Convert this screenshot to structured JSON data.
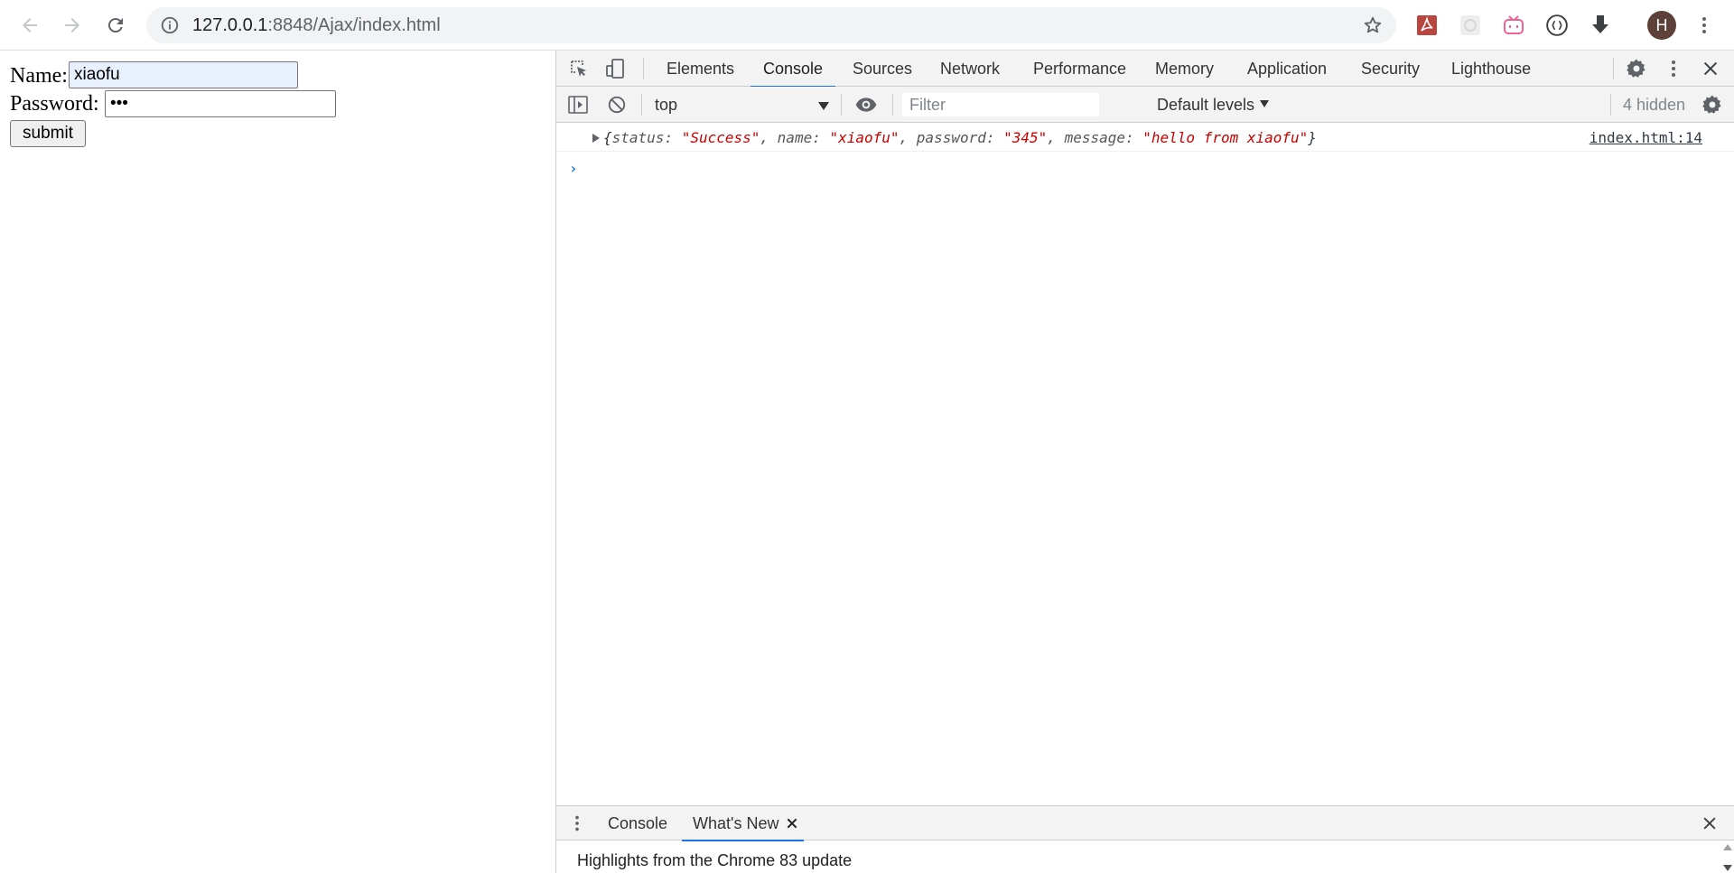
{
  "browser": {
    "url_host": "127.0.0.1",
    "url_rest": ":8848/Ajax/index.html",
    "profile_initial": "H",
    "icons": {
      "back": "arrow-left-icon",
      "forward": "arrow-right-icon",
      "reload": "reload-icon",
      "site_info": "info-circle-icon",
      "bookmark": "star-outline-icon",
      "extensions": [
        "pdf-extension-icon",
        "gray-extension-icon",
        "bilibili-extension-icon",
        "json-viewer-extension-icon",
        "download-arrow-icon"
      ],
      "menu": "vertical-dots-icon"
    }
  },
  "page": {
    "name_label": "Name:",
    "name_value": "xiaofu",
    "password_label": "Password:",
    "password_value": "•••",
    "submit_label": "submit"
  },
  "devtools": {
    "tabs": [
      "Elements",
      "Console",
      "Sources",
      "Network",
      "Performance",
      "Memory",
      "Application",
      "Security",
      "Lighthouse"
    ],
    "active_tab": "Console",
    "console_bar": {
      "context": "top",
      "filter_placeholder": "Filter",
      "levels": "Default levels",
      "hidden": "4 hidden"
    },
    "log": {
      "open": "{",
      "entries": [
        {
          "key": "status",
          "value": "\"Success\""
        },
        {
          "key": "name",
          "value": "\"xiaofu\""
        },
        {
          "key": "password",
          "value": "\"345\""
        },
        {
          "key": "message",
          "value": "\"hello from xiaofu\""
        }
      ],
      "close": "}",
      "source": "index.html:14"
    },
    "prompt": "›",
    "drawer": {
      "tabs": [
        "Console",
        "What's New"
      ],
      "active_tab": "What's New",
      "message": "Highlights from the Chrome 83 update"
    }
  },
  "colors": {
    "accent": "#1a73e8",
    "string_value": "#c80000",
    "autofill": "#e8f0fe",
    "avatar": "#5d4037"
  }
}
